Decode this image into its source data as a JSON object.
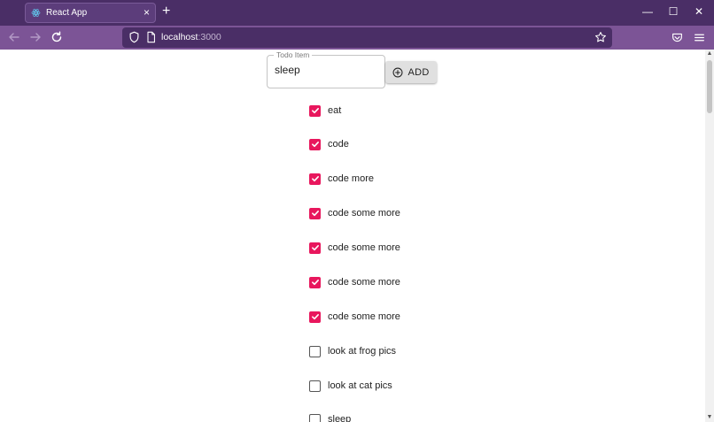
{
  "browser": {
    "tab_title": "React App",
    "tab_close": "×",
    "new_tab": "+",
    "window_controls": {
      "minimize": "—",
      "maximize": "☐",
      "close": "✕"
    },
    "url_host": "localhost",
    "url_port": ":3000"
  },
  "form": {
    "field_label": "Todo Item",
    "input_value": "sleep",
    "add_label": "ADD"
  },
  "todos": [
    {
      "text": "eat",
      "checked": true
    },
    {
      "text": "code",
      "checked": true
    },
    {
      "text": "code more",
      "checked": true
    },
    {
      "text": "code some more",
      "checked": true
    },
    {
      "text": "code some more",
      "checked": true
    },
    {
      "text": "code some more",
      "checked": true
    },
    {
      "text": "code some more",
      "checked": true
    },
    {
      "text": "look at frog pics",
      "checked": false
    },
    {
      "text": "look at cat pics",
      "checked": false
    },
    {
      "text": "sleep",
      "checked": false
    }
  ],
  "colors": {
    "checkbox_checked": "#e8175d",
    "chrome_dark": "#4a2e66",
    "chrome_nav": "#7c5496"
  },
  "icons": [
    "react-icon",
    "back-arrow-icon",
    "forward-arrow-icon",
    "reload-icon",
    "shield-icon",
    "page-icon",
    "star-icon",
    "pocket-icon",
    "menu-icon",
    "add-circle-icon",
    "checkmark-icon"
  ]
}
